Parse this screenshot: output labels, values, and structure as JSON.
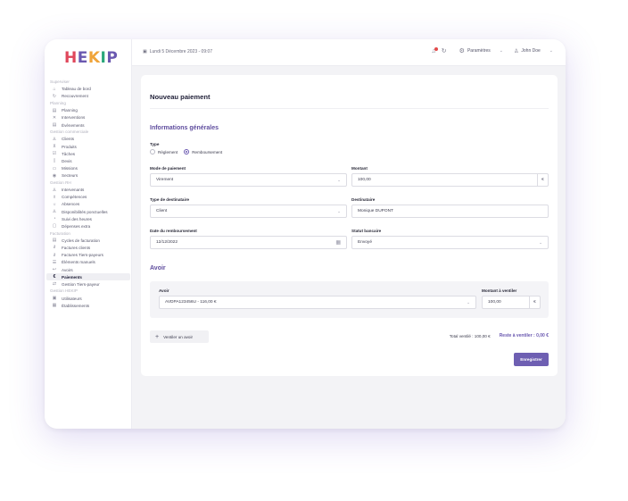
{
  "brand": {
    "logo_letters": [
      "H",
      "E",
      "K",
      "I",
      "P"
    ],
    "logo_colors": [
      "#e0475b",
      "#6a58b0",
      "#f0a43a",
      "#2aa77a",
      "#6a58b0"
    ]
  },
  "sidebar": {
    "groups": [
      {
        "section": "Superviser",
        "items": [
          {
            "label": "Tableau de bord",
            "icon": "home-icon"
          },
          {
            "label": "Recouvrement",
            "icon": "refresh-icon"
          }
        ]
      },
      {
        "section": "Planning",
        "items": [
          {
            "label": "Planning",
            "icon": "calendar-icon"
          },
          {
            "label": "Interventions",
            "icon": "wrench-icon"
          },
          {
            "label": "Évènements",
            "icon": "calendar-event-icon"
          }
        ]
      },
      {
        "section": "Gestion commerciale",
        "items": [
          {
            "label": "Clients",
            "icon": "user-icon"
          },
          {
            "label": "Produits",
            "icon": "cart-icon"
          },
          {
            "label": "Tâches",
            "icon": "checkbox-icon"
          },
          {
            "label": "Devis",
            "icon": "document-icon"
          },
          {
            "label": "Missions",
            "icon": "folder-icon"
          },
          {
            "label": "Secteurs",
            "icon": "map-pin-icon"
          }
        ]
      },
      {
        "section": "Gestion RH",
        "items": [
          {
            "label": "Intervenants",
            "icon": "user-icon"
          },
          {
            "label": "Compétences",
            "icon": "badge-icon"
          },
          {
            "label": "Absences",
            "icon": "sun-icon"
          },
          {
            "label": "Disponibilités ponctuelles",
            "icon": "users-icon"
          },
          {
            "label": "Suivi des heures",
            "icon": "clock-icon"
          },
          {
            "label": "Dépenses extra",
            "icon": "receipt-icon"
          }
        ]
      },
      {
        "section": "Facturation",
        "items": [
          {
            "label": "Cycles de facturation",
            "icon": "calendar-icon"
          },
          {
            "label": "Factures clients",
            "icon": "paperclip-icon"
          },
          {
            "label": "Factures Tiers-payeurs",
            "icon": "paperclip-icon"
          },
          {
            "label": "Éléments manuels",
            "icon": "list-icon"
          },
          {
            "label": "Avoirs",
            "icon": "return-arrow-icon"
          },
          {
            "label": "Paiements",
            "icon": "euro-icon",
            "active": true
          },
          {
            "label": "Gestion Tiers-payeur",
            "icon": "swap-icon"
          }
        ]
      },
      {
        "section": "Gestion HEKIP",
        "items": [
          {
            "label": "Utilisateurs",
            "icon": "id-card-icon"
          },
          {
            "label": "Établissements",
            "icon": "building-icon"
          }
        ]
      }
    ]
  },
  "topbar": {
    "date": "Lundi 5 Décembre 2023 - 09:07",
    "settings_label": "Paramètres",
    "user_name": "John Doe"
  },
  "form": {
    "title": "Nouveau paiement",
    "general_section": "Informations générales",
    "type_label": "Type",
    "type_options": [
      "Règlement",
      "Remboursement"
    ],
    "type_selected": "Remboursement",
    "mode_label": "Mode de paiement",
    "mode_value": "Virement",
    "montant_label": "Montant",
    "montant_value": "100,00",
    "currency": "€",
    "dest_type_label": "Type de destinataire",
    "dest_type_value": "Client",
    "dest_label": "Destinataire",
    "dest_value": "Monique DUPONT",
    "date_label": "Date du remboursement",
    "date_value": "12/12/2022",
    "statut_label": "Statut bancaire",
    "statut_value": "Envoyé",
    "avoir_section": "Avoir",
    "avoir_label": "Avoir",
    "avoir_value": "AVDPA123456U - 116,00 €",
    "ventiler_label": "Montant à ventiler",
    "ventiler_value": "100,00",
    "add_avoir": "Ventiler un avoir",
    "total": "Total ventilé : 100,00 €",
    "reste": "Reste à ventiler : 0,00 €",
    "save": "Enregistrer"
  }
}
